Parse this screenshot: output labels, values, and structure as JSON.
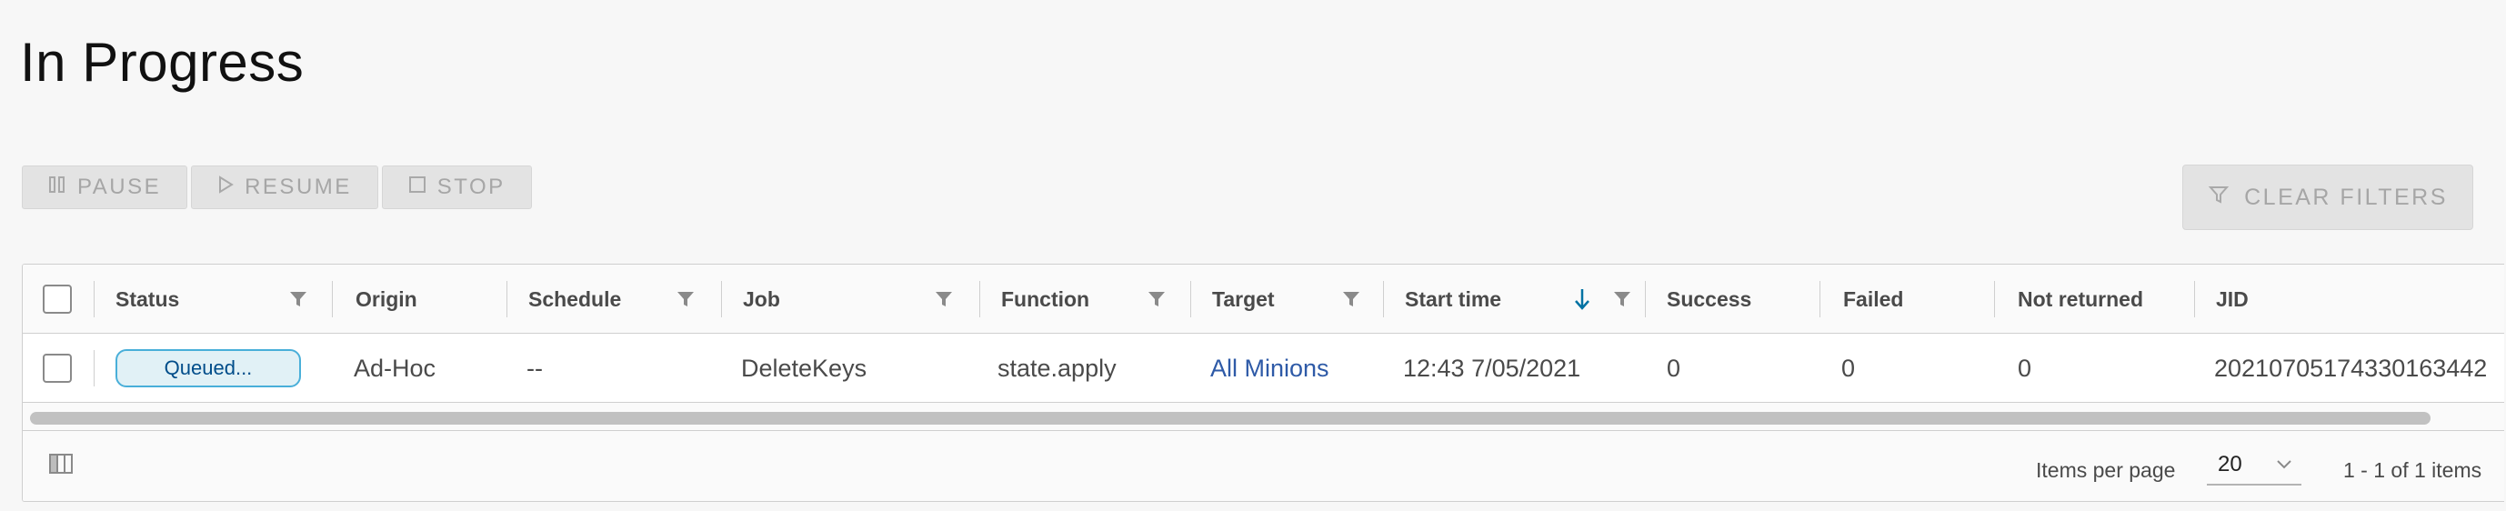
{
  "page": {
    "title": "In Progress"
  },
  "toolbar": {
    "pause_label": "PAUSE",
    "resume_label": "RESUME",
    "stop_label": "STOP",
    "clear_filters_label": "CLEAR FILTERS"
  },
  "table": {
    "columns": [
      "Status",
      "Origin",
      "Schedule",
      "Job",
      "Function",
      "Target",
      "Start time",
      "Success",
      "Failed",
      "Not returned",
      "JID"
    ],
    "sort": {
      "column": "Start time",
      "direction": "descending"
    },
    "rows": [
      {
        "status": "Queued...",
        "origin": "Ad-Hoc",
        "schedule": "--",
        "job": "DeleteKeys",
        "function": "state.apply",
        "target": "All Minions",
        "start_time": "12:43 7/05/2021",
        "success": "0",
        "failed": "0",
        "not_returned": "0",
        "jid": "20210705174330163442"
      }
    ]
  },
  "footer": {
    "items_per_page_label": "Items per page",
    "items_per_page_value": "20",
    "pagination_text": "1 - 1 of 1 items"
  },
  "colors": {
    "link": "#0072a3",
    "badge_border": "#49afd9",
    "badge_bg": "#e1f1f6",
    "sort_arrow": "#0072a3"
  }
}
